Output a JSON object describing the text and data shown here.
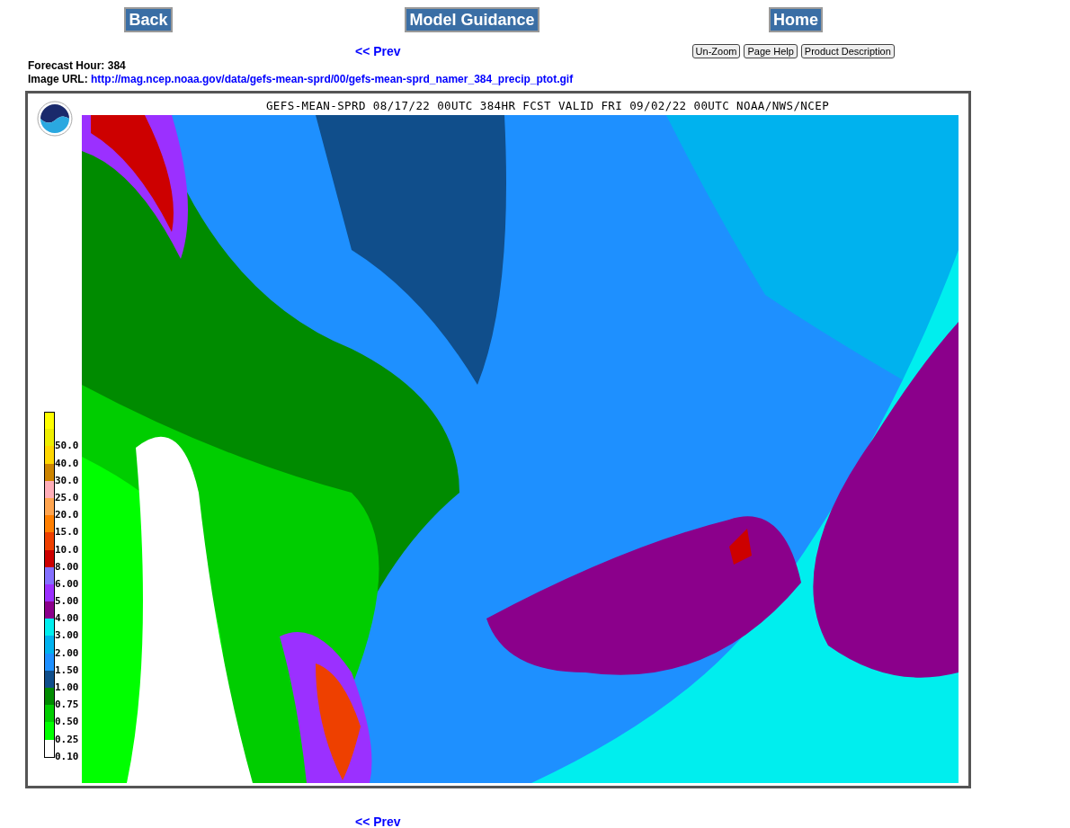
{
  "nav_buttons": [
    "Back",
    "Model Guidance",
    "Home"
  ],
  "prev_link": "<< Prev",
  "tool_buttons": [
    "Un-Zoom",
    "Page Help",
    "Product Description"
  ],
  "forecast_hour": {
    "label": "Forecast Hour:",
    "value": "384"
  },
  "image_url": {
    "label": "Image URL:",
    "link": "http://mag.ncep.noaa.gov/data/gefs-mean-sprd/00/gefs-mean-sprd_namer_384_precip_ptot.gif"
  },
  "map": {
    "title": "GEFS-MEAN-SPRD 08/17/22 00UTC 384HR FCST VALID FRI 09/02/22 00UTC NOAA/NWS/NCEP",
    "legend": [
      {
        "color": "#ffff00"
      },
      {
        "label": "50.0",
        "color": "#eeee00"
      },
      {
        "label": "40.0",
        "color": "#ffd700"
      },
      {
        "label": "30.0",
        "color": "#cd8500"
      },
      {
        "label": "25.0",
        "color": "#ffaeb9"
      },
      {
        "label": "20.0",
        "color": "#ffa54f"
      },
      {
        "label": "15.0",
        "color": "#ff7f00"
      },
      {
        "label": "10.0",
        "color": "#ee4000"
      },
      {
        "label": "8.00",
        "color": "#cd0000"
      },
      {
        "label": "6.00",
        "color": "#8470ff"
      },
      {
        "label": "5.00",
        "color": "#9b30ff"
      },
      {
        "label": "4.00",
        "color": "#8b008b"
      },
      {
        "label": "3.00",
        "color": "#00eeee"
      },
      {
        "label": "2.00",
        "color": "#00b2ee"
      },
      {
        "label": "1.50",
        "color": "#1e90ff"
      },
      {
        "label": "1.00",
        "color": "#104e8b"
      },
      {
        "label": "0.75",
        "color": "#008b00"
      },
      {
        "label": "0.50",
        "color": "#00cd00"
      },
      {
        "label": "0.25",
        "color": "#00ff00"
      },
      {
        "label": "0.10",
        "color": "#ffffff"
      }
    ]
  },
  "bottom_prev_link": "<< Prev"
}
